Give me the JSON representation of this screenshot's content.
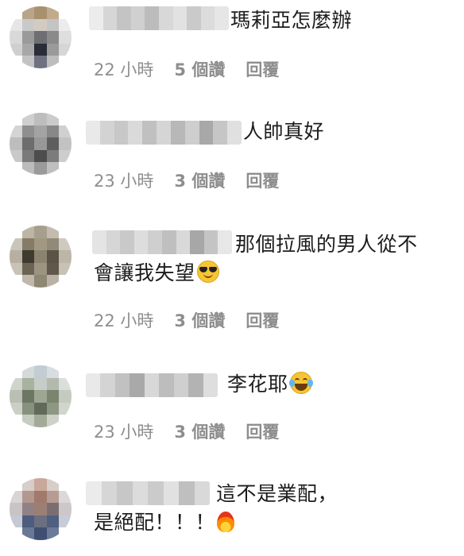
{
  "comments": [
    {
      "text_line1": "瑪莉亞怎麼辦",
      "text_line2": "",
      "time": "22 小時",
      "likes": "5 個讚",
      "reply": "回覆",
      "emoji": ""
    },
    {
      "text_line1": "人帥真好",
      "text_line2": "",
      "time": "23 小時",
      "likes": "3 個讚",
      "reply": "回覆",
      "emoji": ""
    },
    {
      "text_line1": "那個拉風的男人從不",
      "text_line2": "會讓我失望",
      "time": "22 小時",
      "likes": "3 個讚",
      "reply": "回覆",
      "emoji": "smiling-face-with-sunglasses"
    },
    {
      "text_line1": "李花耶",
      "text_line2": "",
      "time": "23 小時",
      "likes": "3 個讚",
      "reply": "回覆",
      "emoji": "face-with-tears-of-joy"
    },
    {
      "text_line1": "這不是業配，",
      "text_line2": "是絕配！！！",
      "time": "",
      "likes": "",
      "reply": "",
      "emoji": "fire"
    }
  ],
  "colors": {
    "meta_text": "#8e8e8e",
    "body_text": "#1c1c1c",
    "background": "#ffffff"
  }
}
